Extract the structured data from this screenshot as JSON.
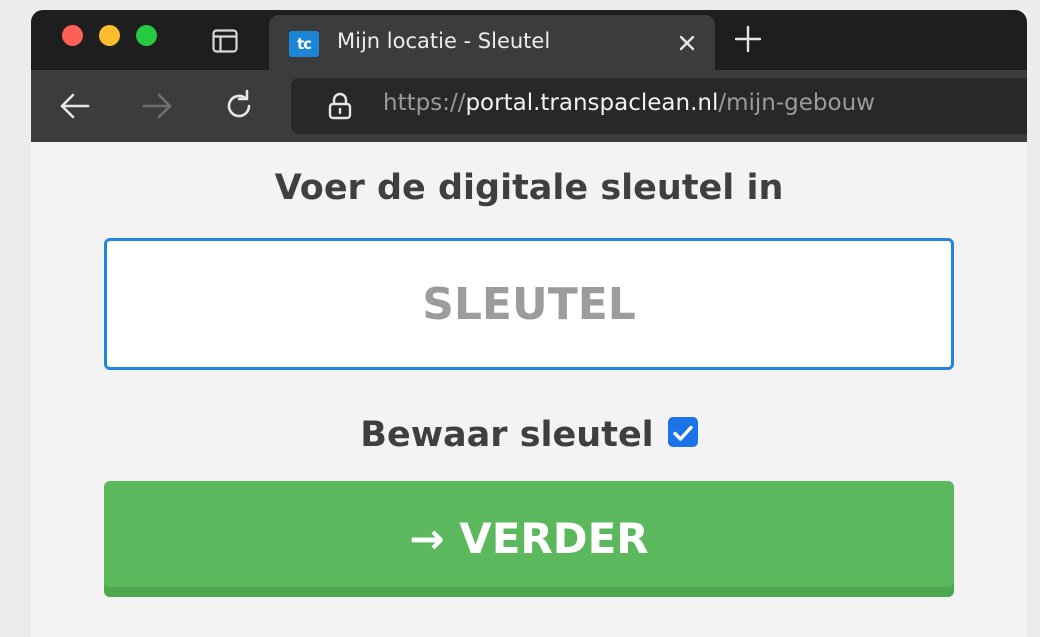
{
  "browser": {
    "tab": {
      "favicon_text": "tc",
      "title": "Mijn locatie - Sleutel"
    },
    "address": {
      "scheme": "https://",
      "host": "portal.transpaclean.nl",
      "path": "/mijn-gebouw"
    },
    "icons": {
      "back": "arrow-left-icon",
      "forward": "arrow-right-icon",
      "reload": "reload-icon",
      "lock": "lock-icon",
      "close": "close-icon",
      "new_tab": "plus-icon",
      "tabs_overview": "tab-overview-icon"
    }
  },
  "page": {
    "heading": "Voer de digitale sleutel in",
    "key_field": {
      "placeholder": "SLEUTEL",
      "value": ""
    },
    "save_key": {
      "label": "Bewaar sleutel",
      "checked": true
    },
    "submit": {
      "label": "→ VERDER"
    }
  },
  "colors": {
    "accent_blue": "#2184dd",
    "button_green": "#5cb85c",
    "checkbox_blue": "#1a73e8"
  }
}
